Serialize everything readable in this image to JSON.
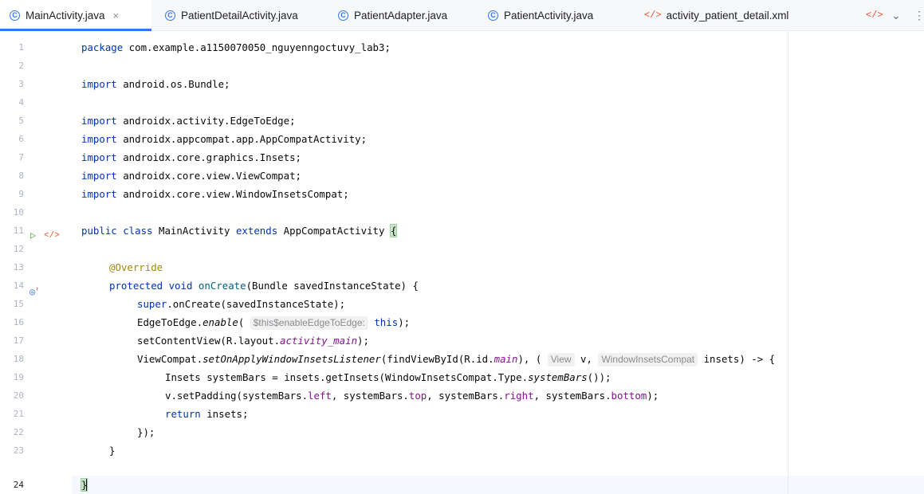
{
  "tabs": [
    {
      "label": "MainActivity.java",
      "icon": "java-class-icon",
      "active": true,
      "closable": true
    },
    {
      "label": "PatientDetailActivity.java",
      "icon": "java-class-icon"
    },
    {
      "label": "PatientAdapter.java",
      "icon": "java-class-icon"
    },
    {
      "label": "PatientActivity.java",
      "icon": "java-class-icon"
    },
    {
      "label": "activity_patient_detail.xml",
      "icon": "xml-file-icon"
    }
  ],
  "editor": {
    "line_numbers": [
      "1",
      "2",
      "3",
      "4",
      "5",
      "6",
      "7",
      "8",
      "9",
      "10",
      "11",
      "12",
      "13",
      "14",
      "15",
      "16",
      "17",
      "18",
      "19",
      "20",
      "21",
      "22",
      "23",
      "24"
    ],
    "code": {
      "l1_kw": "package",
      "l1_rest": " com.example.a1150070050_nguyenngoctuvy_lab3;",
      "l3_kw": "import",
      "l3_rest": " android.os.Bundle;",
      "l5_kw": "import",
      "l5_rest": " androidx.activity.EdgeToEdge;",
      "l6_kw": "import",
      "l6_rest": " androidx.appcompat.app.AppCompatActivity;",
      "l7_kw": "import",
      "l7_rest": " androidx.core.graphics.Insets;",
      "l8_kw": "import",
      "l8_rest": " androidx.core.view.ViewCompat;",
      "l9_kw": "import",
      "l9_rest": " androidx.core.view.WindowInsetsCompat;",
      "l11_kw1": "public class",
      "l11_mid": " MainActivity ",
      "l11_kw2": "extends",
      "l11_rest": " AppCompatActivity ",
      "l11_brace": "{",
      "l13_ann": "@Override",
      "l14_kw": "protected void",
      "l14_fn": "onCreate",
      "l14_rest": "(Bundle savedInstanceState) {",
      "l15_kw": "super",
      "l15_rest": ".onCreate(savedInstanceState);",
      "l16_a": "EdgeToEdge.",
      "l16_b": "enable",
      "l16_c": "( ",
      "l16_hint": "$this$enableEdgeToEdge:",
      "l16_kw": "this",
      "l16_d": ");",
      "l17_a": "setContentView(R.layout.",
      "l17_b": "activity_main",
      "l17_c": ");",
      "l18_a": "ViewCompat.",
      "l18_b": "setOnApplyWindowInsetsListener",
      "l18_c": "(findViewById(R.id.",
      "l18_d": "main",
      "l18_e": "), (",
      "l18_hint1": "View",
      "l18_f": " v, ",
      "l18_hint2": "WindowInsetsCompat",
      "l18_g": " insets) -> {",
      "l19_a": "Insets systemBars = insets.getInsets(WindowInsetsCompat.Type.",
      "l19_b": "systemBars",
      "l19_c": "());",
      "l20_a": "v.setPadding(systemBars.",
      "l20_b": "left",
      "l20_c": ", systemBars.",
      "l20_d": "top",
      "l20_e": ", systemBars.",
      "l20_f": "right",
      "l20_g": ", systemBars.",
      "l20_h": "bottom",
      "l20_i": ");",
      "l21_kw": "return",
      "l21_rest": " insets;",
      "l22": "});",
      "l23": "}",
      "l24": "}"
    }
  },
  "colors": {
    "accent": "#3574f0",
    "keyword": "#0033b3",
    "annotation": "#9e880d",
    "method": "#00627a",
    "field": "#871094",
    "run": "#43a047",
    "xml": "#e55230"
  }
}
